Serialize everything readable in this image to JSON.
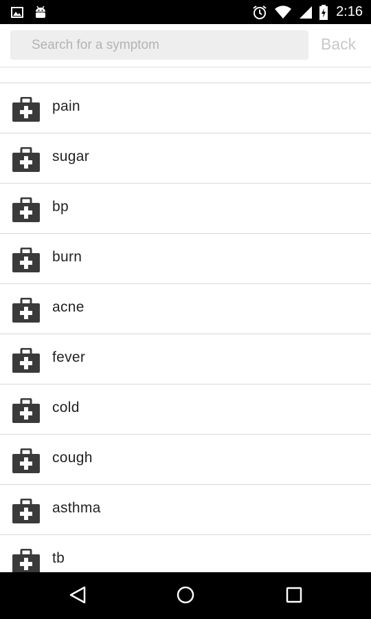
{
  "status_bar": {
    "time": "2:16",
    "icons": [
      "image-icon",
      "android-icon",
      "alarm-icon",
      "wifi-icon",
      "signal-icon",
      "battery-charging-icon"
    ]
  },
  "header": {
    "search_placeholder": "Search for a symptom",
    "search_value": "",
    "back_label": "Back"
  },
  "symptoms": [
    {
      "label": "pain"
    },
    {
      "label": "sugar"
    },
    {
      "label": "bp"
    },
    {
      "label": "burn"
    },
    {
      "label": "acne"
    },
    {
      "label": "fever"
    },
    {
      "label": "cold"
    },
    {
      "label": "cough"
    },
    {
      "label": "asthma"
    },
    {
      "label": "tb"
    }
  ],
  "item_icon": "medical-kit-icon",
  "nav_bar": {
    "icons": [
      "back-triangle-icon",
      "home-circle-icon",
      "recents-square-icon"
    ]
  },
  "colors": {
    "status_bar": "#000000",
    "search_bg": "#eeeeee",
    "placeholder": "#b3b3b3",
    "back_text": "#c8c8c8",
    "icon": "#3a3a3a",
    "divider": "#d8d8d8"
  }
}
